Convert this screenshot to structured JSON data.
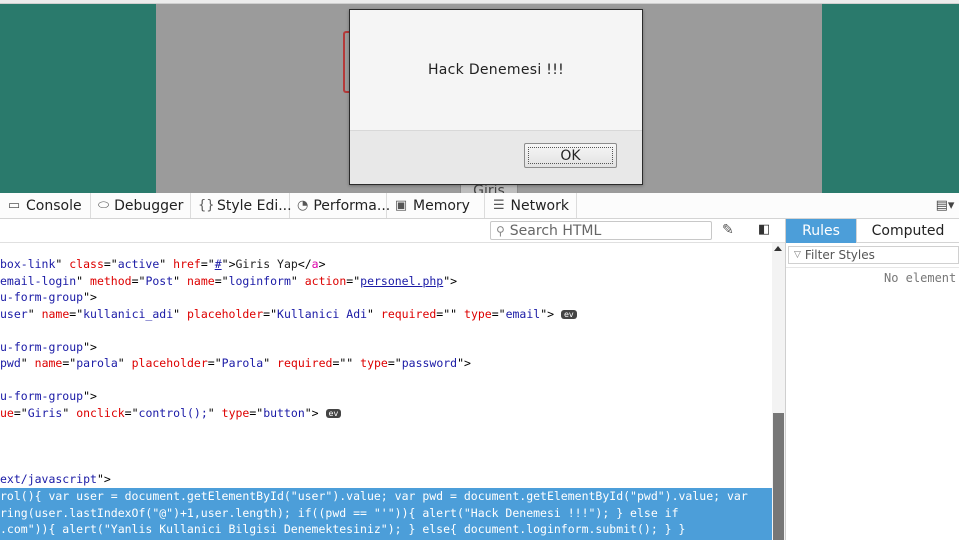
{
  "dialog": {
    "message": "Hack Denemesi !!!",
    "ok_label": "OK"
  },
  "page": {
    "button_fragment": "Giris"
  },
  "colors": {
    "page_background": "#2a7a6c",
    "selection": "#4c9ed9",
    "tag": "#dd00a9",
    "attribute": "#dd0000",
    "value": "#1a1aa6"
  },
  "toolbar": {
    "tabs": [
      {
        "label": "Console",
        "icon": "console-icon"
      },
      {
        "label": "Debugger",
        "icon": "debugger-icon"
      },
      {
        "label": "Style Edi...",
        "icon": "braces-icon"
      },
      {
        "label": "Performa...",
        "icon": "performance-icon"
      },
      {
        "label": "Memory",
        "icon": "memory-icon"
      },
      {
        "label": "Network",
        "icon": "network-icon"
      }
    ],
    "dock_icon": "dock-icon"
  },
  "inspector": {
    "search_placeholder": "Search HTML",
    "lines": {
      "l1": {
        "a": "box-link",
        "b": "class",
        "c": "active",
        "d": "href",
        "e": "#",
        "f": "Giris Yap",
        "g": "a"
      },
      "l2": {
        "a": "email-login",
        "b": "method",
        "c": "Post",
        "d": "name",
        "e": "loginform",
        "f": "action",
        "g": "personel.php"
      },
      "l3": {
        "a": "u-form-group"
      },
      "l4": {
        "a": "user",
        "b": "name",
        "c": "kullanici_adi",
        "d": "placeholder",
        "e": "Kullanici Adi",
        "f": "required",
        "g": "",
        "h": "type",
        "i": "email",
        "j": "ev"
      },
      "l5": {
        "a": "u-form-group"
      },
      "l6": {
        "a": "pwd",
        "b": "name",
        "c": "parola",
        "d": "placeholder",
        "e": "Parola",
        "f": "required",
        "g": "",
        "h": "type",
        "i": "password"
      },
      "l7": {
        "a": "u-form-group"
      },
      "l8": {
        "a": "ue",
        "b": "Giris",
        "c": "onclick",
        "d": "control();",
        "e": "type",
        "f": "button",
        "g": "ev"
      },
      "l9": {
        "a": "ext/javascript"
      }
    },
    "script_lines": [
      "rol(){ var user = document.getElementById(\"user\").value; var pwd = document.getElementById(\"pwd\").value; var",
      "ring(user.lastIndexOf(\"@\")+1,user.length); if((pwd == \"'\")){ alert(\"Hack Denemesi !!!\"); } else if",
      ".com\")){ alert(\"Yanlis Kullanici Bilgisi Denemektesiniz\"); } else{ document.loginform.submit(); } }"
    ]
  },
  "side_panel": {
    "tab_rules": "Rules",
    "tab_computed": "Computed",
    "filter_placeholder": "Filter Styles",
    "empty_text": "No element"
  }
}
